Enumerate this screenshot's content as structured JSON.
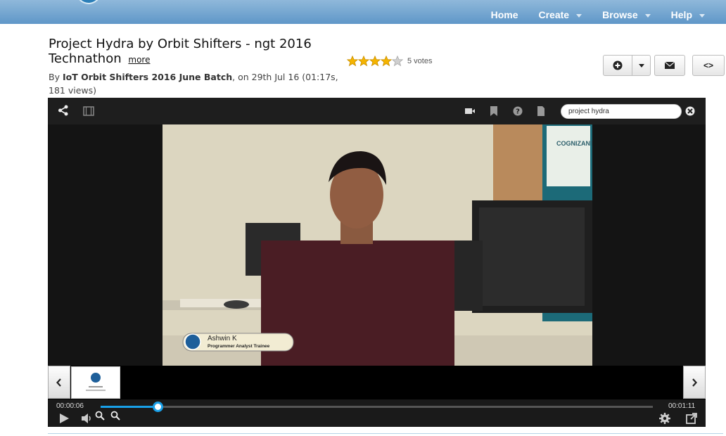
{
  "nav": {
    "items": [
      {
        "label": "Home",
        "dropdown": false
      },
      {
        "label": "Create",
        "dropdown": true
      },
      {
        "label": "Browse",
        "dropdown": true
      },
      {
        "label": "Help",
        "dropdown": true
      }
    ]
  },
  "video": {
    "title": "Project Hydra by Orbit Shifters - ngt 2016 Technathon",
    "more_label": "more",
    "by_prefix": "By ",
    "author": "IoT Orbit Shifters 2016 June Batch",
    "meta": ", on 29th Jul 16 (01:17s, 181 views)",
    "rating": 4,
    "votes_label": "5 votes"
  },
  "actions": {
    "add_label": "+",
    "email_label": "✉",
    "embed_label": "<>"
  },
  "player": {
    "search_value": "project hydra",
    "overlay_name": "Ashwin K",
    "overlay_role": "Programmer Analyst Trainee",
    "poster_brand": "COGNIZANT",
    "current_time": "00:00:06",
    "duration": "00:01:11",
    "progress_fraction": 0.103
  },
  "colors": {
    "accent": "#19a0e8",
    "nav_bg": "#6fa3cf",
    "star": "#f5b400"
  }
}
